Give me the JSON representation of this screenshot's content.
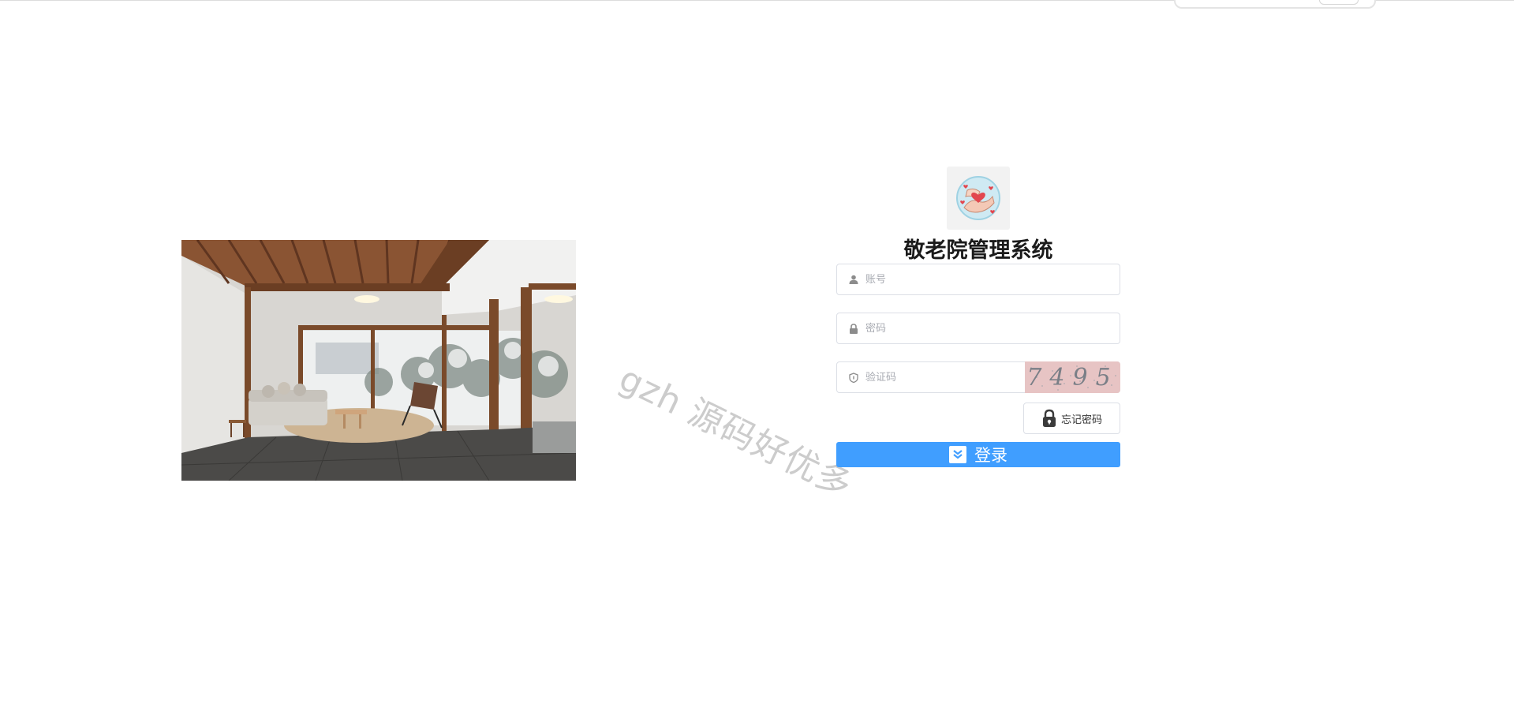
{
  "app": {
    "title": "敬老院管理系统"
  },
  "login": {
    "username_placeholder": "账号",
    "password_placeholder": "密码",
    "captcha_placeholder": "验证码",
    "captcha_code": "7495",
    "forgot_label": "忘记密码",
    "submit_label": "登录"
  },
  "watermark": "gzh 源码好优多",
  "icons": {
    "user": "user-icon",
    "lock": "lock-icon",
    "shield": "shield-icon",
    "padlock": "padlock-icon",
    "check": "check-icon"
  },
  "colors": {
    "primary": "#409eff",
    "border": "#dcdfe6",
    "captcha_bg": "#e7c4c4"
  }
}
